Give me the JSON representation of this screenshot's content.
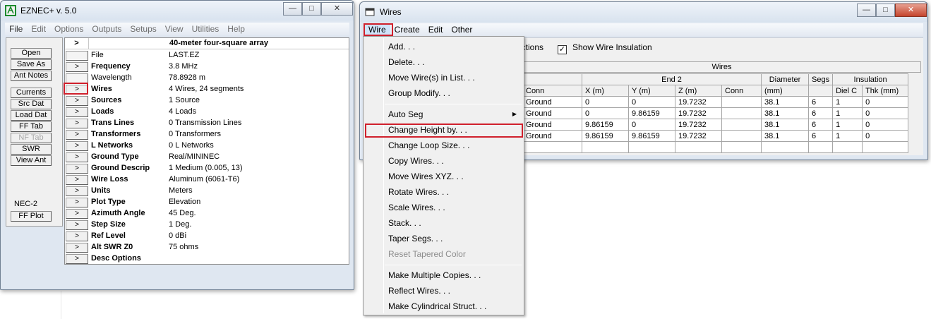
{
  "eznec": {
    "title": "EZNEC+  v. 5.0",
    "menu": [
      "File",
      "Edit",
      "Options",
      "Outputs",
      "Setups",
      "View",
      "Utilities",
      "Help"
    ],
    "buttons": [
      "Open",
      "Save As",
      "Ant Notes",
      "Currents",
      "Src Dat",
      "Load Dat",
      "FF Tab",
      "NF Tab",
      "SWR",
      "View Ant"
    ],
    "nec_label": "NEC-2",
    "ffplot": "FF Plot",
    "grid_title": "40-meter four-square array",
    "grid_arrow": ">",
    "rows": [
      {
        "name": "File",
        "value": "LAST.EZ"
      },
      {
        "name": "Frequency",
        "value": "3.8 MHz"
      },
      {
        "name": "Wavelength",
        "value": "78.8928 m"
      },
      {
        "name": "Wires",
        "value": "4 Wires, 24 segments"
      },
      {
        "name": "Sources",
        "value": "1 Source"
      },
      {
        "name": "Loads",
        "value": "4 Loads"
      },
      {
        "name": "Trans Lines",
        "value": "0 Transmission Lines"
      },
      {
        "name": "Transformers",
        "value": "0 Transformers"
      },
      {
        "name": "L Networks",
        "value": "0 L Networks"
      },
      {
        "name": "Ground Type",
        "value": "Real/MININEC"
      },
      {
        "name": "Ground Descrip",
        "value": "1 Medium (0.005, 13)"
      },
      {
        "name": "Wire Loss",
        "value": "Aluminum (6061-T6)"
      },
      {
        "name": "Units",
        "value": "Meters"
      },
      {
        "name": "Plot Type",
        "value": "Elevation"
      },
      {
        "name": "Azimuth Angle",
        "value": "45 Deg."
      },
      {
        "name": "Step Size",
        "value": "1 Deg."
      },
      {
        "name": "Ref Level",
        "value": "0 dBi"
      },
      {
        "name": "Alt SWR Z0",
        "value": "75 ohms"
      },
      {
        "name": "Desc Options",
        "value": ""
      }
    ]
  },
  "wires": {
    "title": "Wires",
    "menu": [
      "Wire",
      "Create",
      "Edit",
      "Other"
    ],
    "connections_partial": "ections",
    "show_insulation": "Show Wire Insulation",
    "table": {
      "group_title": "Wires",
      "end2": "End 2",
      "diameter": "Diameter",
      "segs": "Segs",
      "insulation": "Insulation",
      "cols": [
        "Conn",
        "X (m)",
        "Y (m)",
        "Z (m)",
        "Conn",
        "(mm)",
        "",
        "Diel C",
        "Thk (mm)"
      ],
      "rows": [
        [
          "Ground",
          "0",
          "0",
          "19.7232",
          "",
          "38.1",
          "6",
          "1",
          "0"
        ],
        [
          "Ground",
          "0",
          "9.86159",
          "19.7232",
          "",
          "38.1",
          "6",
          "1",
          "0"
        ],
        [
          "Ground",
          "9.86159",
          "0",
          "19.7232",
          "",
          "38.1",
          "6",
          "1",
          "0"
        ],
        [
          "Ground",
          "9.86159",
          "9.86159",
          "19.7232",
          "",
          "38.1",
          "6",
          "1",
          "0"
        ],
        [
          "",
          "",
          "",
          "",
          "",
          "",
          "",
          "",
          ""
        ]
      ]
    }
  },
  "dropdown": {
    "items": [
      {
        "label": "Add. . .",
        "group": 0
      },
      {
        "label": "Delete. . .",
        "group": 0
      },
      {
        "label": "Move Wire(s) in List. . .",
        "group": 0
      },
      {
        "label": "Group Modify. . .",
        "group": 0
      },
      {
        "label": "Auto Seg",
        "group": 1,
        "submenu": true
      },
      {
        "label": "Change Height by. . .",
        "group": 1,
        "highlighted": true
      },
      {
        "label": "Change Loop Size. . .",
        "group": 1
      },
      {
        "label": "Copy Wires. . .",
        "group": 1
      },
      {
        "label": "Move Wires XYZ. . .",
        "group": 1
      },
      {
        "label": "Rotate Wires. . .",
        "group": 1
      },
      {
        "label": "Scale Wires. . .",
        "group": 1
      },
      {
        "label": "Stack. . .",
        "group": 1
      },
      {
        "label": "Taper Segs. . .",
        "group": 1
      },
      {
        "label": "Reset Tapered Color",
        "group": 1,
        "disabled": true
      },
      {
        "label": "Make Multiple Copies. . .",
        "group": 2
      },
      {
        "label": "Reflect Wires. . .",
        "group": 2
      },
      {
        "label": "Make Cylindrical Struct. . .",
        "group": 2
      }
    ]
  },
  "colors": {
    "highlight_box": "#d0202c",
    "window_frame": "#dfe7f1"
  }
}
